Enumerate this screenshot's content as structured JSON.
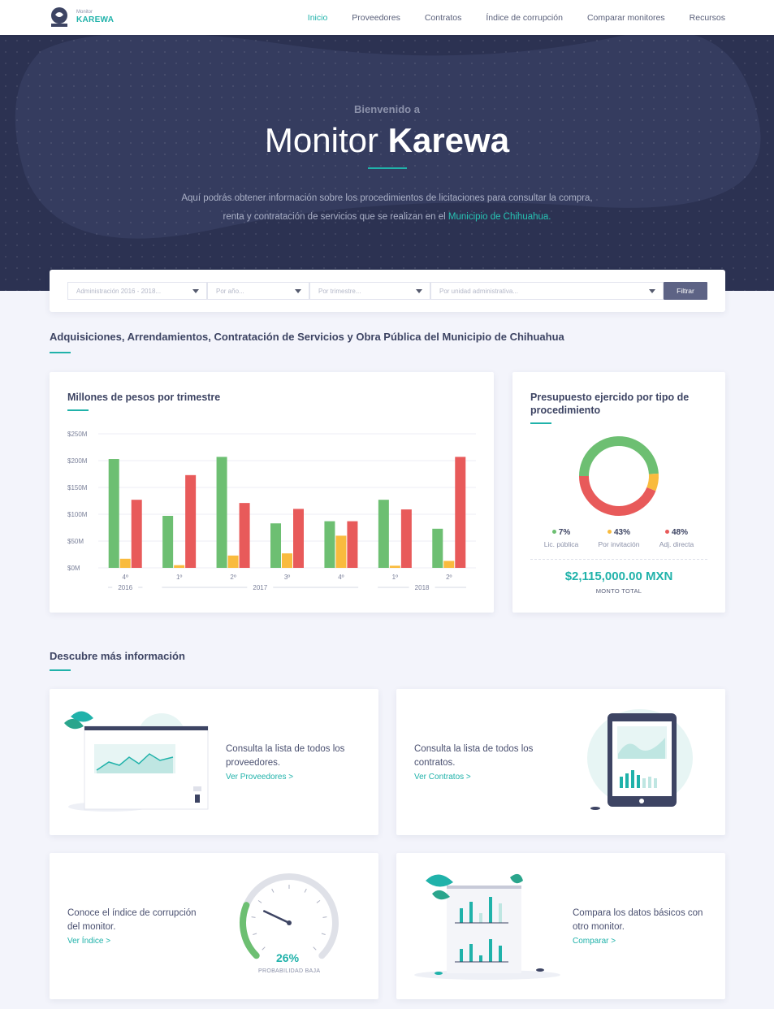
{
  "nav": {
    "logo_small": "Monitor",
    "logo_big": "KAREWA",
    "links": [
      "Inicio",
      "Proveedores",
      "Contratos",
      "Índice de corrupción",
      "Comparar monitores",
      "Recursos"
    ]
  },
  "hero": {
    "welcome": "Bienvenido a",
    "title_light": "Monitor ",
    "title_bold": "Karewa",
    "desc_1": "Aquí podrás obtener información sobre los procedimientos de licitaciones para consultar la compra,",
    "desc_2": "renta y contratación de servicios que se realizan en el ",
    "desc_highlight": "Municipio de Chihuahua."
  },
  "filter": {
    "admin": "Administración 2016 - 2018...",
    "year": "Por año...",
    "quarter": "Por trimestre...",
    "unit": "Por unidad administrativa...",
    "button": "Filtrar"
  },
  "section1_title": "Adquisiciones, Arrendamientos, Contratación de Servicios y Obra Pública del Municipio de Chihuahua",
  "bar_card_title": "Millones de pesos por trimestre",
  "donut_card_title_1": "Presupuesto ejercido por tipo de",
  "donut_card_title_2": "procedimiento",
  "chart_data": [
    {
      "type": "bar",
      "title": "Millones de pesos por trimestre",
      "categories": [
        "4º",
        "1º",
        "2º",
        "3º",
        "4º",
        "1º",
        "2º"
      ],
      "year_groups": [
        {
          "label": "2016",
          "start": 0,
          "end": 0
        },
        {
          "label": "2017",
          "start": 1,
          "end": 4
        },
        {
          "label": "2018",
          "start": 5,
          "end": 6
        }
      ],
      "y_ticks": [
        "$0M",
        "$50M",
        "$100M",
        "$150M",
        "$200M",
        "$250M"
      ],
      "ylim": [
        0,
        250
      ],
      "series": [
        {
          "color": "#6dbf72",
          "values": [
            203,
            97,
            207,
            83,
            87,
            127,
            73
          ]
        },
        {
          "color": "#f9bb3e",
          "values": [
            17,
            5,
            23,
            27,
            60,
            4,
            13
          ]
        },
        {
          "color": "#e85a5a",
          "values": [
            127,
            173,
            121,
            110,
            87,
            109,
            207
          ]
        }
      ]
    },
    {
      "type": "pie",
      "slices": [
        {
          "label": "Lic. pública",
          "pct": "7%",
          "value": 48,
          "color": "#6dbf72"
        },
        {
          "label": "Por invitación",
          "pct": "43%",
          "value": 7,
          "color": "#f9bb3e"
        },
        {
          "label": "Adj. directa",
          "pct": "48%",
          "value": 43,
          "color": "#e85a5a"
        }
      ],
      "total": "$2,115,000.00 MXN",
      "total_label": "MONTO TOTAL"
    }
  ],
  "section2_title": "Descubre más información",
  "cards": {
    "proveedores_text": "Consulta la lista de todos los proveedores.",
    "proveedores_link": "Ver Proveedores >",
    "contratos_text": "Consulta la lista de todos los contratos.",
    "contratos_link": "Ver Contratos >",
    "indice_text": "Conoce el índice de corrupción del monitor.",
    "indice_link": "Ver Índice >",
    "gauge_value": "26%",
    "gauge_label": "PROBABILIDAD BAJA",
    "gauge_level": 0.26,
    "comparar_text": "Compara los datos básicos con otro monitor.",
    "comparar_link": "Comparar >"
  },
  "colors": {
    "accent": "#20b2aa",
    "navy": "#2c3252"
  }
}
